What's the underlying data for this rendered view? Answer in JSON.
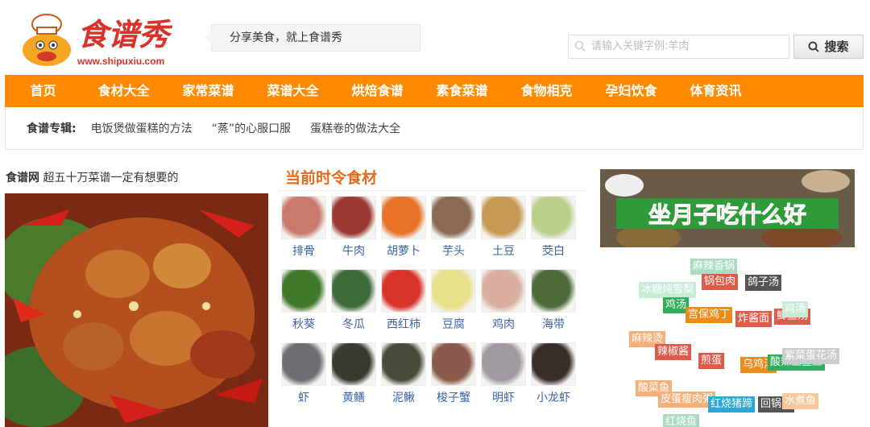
{
  "header": {
    "logo_text": "食谱秀",
    "logo_url": "www.shipuxiu.com",
    "slogan": "分享美食，就上食谱秀",
    "search_placeholder": "请输入关键字例:羊肉",
    "search_button": "搜索"
  },
  "nav": {
    "items": [
      "首页",
      "食材大全",
      "家常菜谱",
      "菜谱大全",
      "烘焙食谱",
      "素食菜谱",
      "食物相克",
      "孕妇饮食",
      "体育资讯"
    ]
  },
  "topics": {
    "label": "食谱专辑:",
    "links": [
      "电饭煲做蛋糕的方法",
      "“蒸”的心服口服",
      "蛋糕卷的做法大全"
    ]
  },
  "left": {
    "site": "食谱网",
    "tagline": "超五十万菜谱一定有想要的"
  },
  "season": {
    "title": "当前时令食材",
    "items": [
      {
        "label": "排骨",
        "color": "#c97a6a"
      },
      {
        "label": "牛肉",
        "color": "#9b3a32"
      },
      {
        "label": "胡萝卜",
        "color": "#e8742a"
      },
      {
        "label": "芋头",
        "color": "#8a6a52"
      },
      {
        "label": "土豆",
        "color": "#c69a55"
      },
      {
        "label": "茭白",
        "color": "#b9cf8a"
      },
      {
        "label": "秋葵",
        "color": "#3f7a2c"
      },
      {
        "label": "冬瓜",
        "color": "#3d6b3a"
      },
      {
        "label": "西红柿",
        "color": "#d9342b"
      },
      {
        "label": "豆腐",
        "color": "#e8e08a"
      },
      {
        "label": "鸡肉",
        "color": "#d9b0a0"
      },
      {
        "label": "海带",
        "color": "#4e6b3a"
      },
      {
        "label": "虾",
        "color": "#6d6d72"
      },
      {
        "label": "黄鳝",
        "color": "#3a3a30"
      },
      {
        "label": "泥鳅",
        "color": "#4a4a3a"
      },
      {
        "label": "梭子蟹",
        "color": "#8a5a4a"
      },
      {
        "label": "明虾",
        "color": "#a09aa0"
      },
      {
        "label": "小龙虾",
        "color": "#3a2e2a"
      }
    ]
  },
  "banner": {
    "text": "坐月子吃什么好"
  },
  "tags": [
    {
      "text": "麻辣香锅",
      "color": "#a9dcc0"
    },
    {
      "text": "锅包肉",
      "color": "#e05a4a"
    },
    {
      "text": "鸽子汤",
      "color": "#555555"
    },
    {
      "text": "冰糖炖雪梨",
      "color": "#c9ecd6"
    },
    {
      "text": "鸡汤",
      "color": "#2fae5c"
    },
    {
      "text": "宫保鸡丁",
      "color": "#f08a1a"
    },
    {
      "text": "炸酱面",
      "color": "#e05a4a"
    },
    {
      "text": "鲫鱼汤",
      "color": "#e05a4a"
    },
    {
      "text": "鸡汤",
      "color": "#c9ecd6"
    },
    {
      "text": "麻辣烫",
      "color": "#f4b07a"
    },
    {
      "text": "辣椒酱",
      "color": "#e05a4a"
    },
    {
      "text": "煎蛋",
      "color": "#e05a4a"
    },
    {
      "text": "乌鸡汤",
      "color": "#f08a1a"
    },
    {
      "text": "酸辣土豆丝",
      "color": "#2fae5c"
    },
    {
      "text": "紫菜蛋花汤",
      "color": "#cccccc"
    },
    {
      "text": "酸菜鱼",
      "color": "#f4b07a"
    },
    {
      "text": "皮蛋瘦肉粥",
      "color": "#f4b07a"
    },
    {
      "text": "红烧猪蹄",
      "color": "#2aa8d8"
    },
    {
      "text": "回锅肉",
      "color": "#555555"
    },
    {
      "text": "水煮鱼",
      "color": "#f9c89a"
    },
    {
      "text": "红烧鱼",
      "color": "#a9dcc0"
    }
  ]
}
